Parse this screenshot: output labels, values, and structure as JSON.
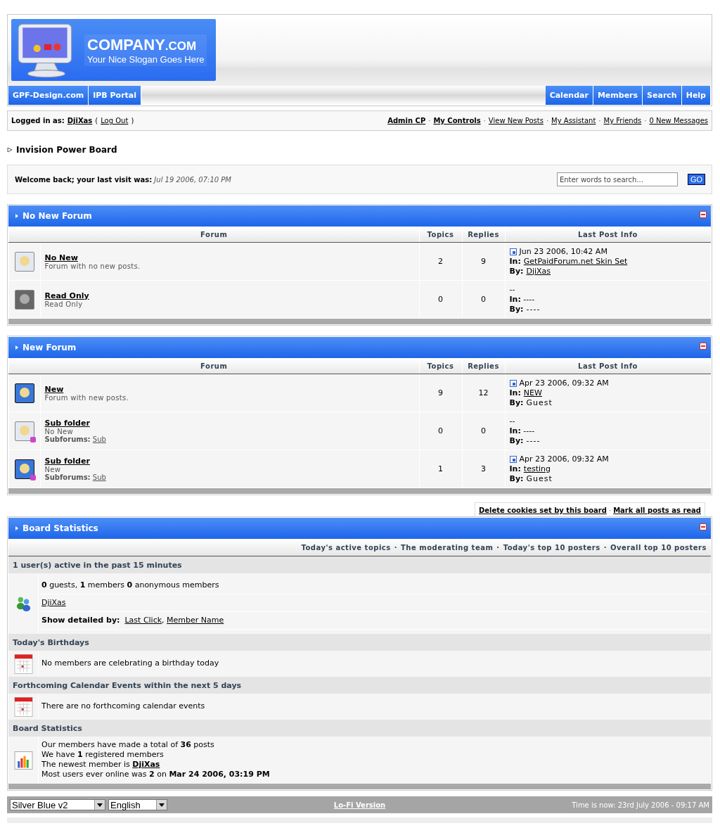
{
  "logo": {
    "name": "COMPANY",
    "suffix": ".COM",
    "slogan": "Your Nice Slogan Goes Here"
  },
  "nav_left": [
    "GPF-Design.com",
    "IPB Portal"
  ],
  "nav_right": [
    "Calendar",
    "Members",
    "Search",
    "Help"
  ],
  "userbar": {
    "label": "Logged in as:",
    "user": "DjiXas",
    "open": "(",
    "logout": "Log Out",
    "close": ")",
    "separator": "·",
    "links": [
      {
        "text": "Admin CP",
        "bold": true
      },
      {
        "text": "My Controls",
        "bold": true
      },
      {
        "text": "View New Posts",
        "bold": false
      },
      {
        "text": "My Assistant",
        "bold": false
      },
      {
        "text": "My Friends",
        "bold": false
      },
      {
        "text": "0 New Messages",
        "bold": false
      }
    ]
  },
  "breadcrumb": "Invision Power Board",
  "welcome": {
    "label": "Welcome back; your last visit was:",
    "date": "Jul 19 2006, 07:10 PM",
    "search_placeholder": "Enter words to search...",
    "go": "GO"
  },
  "categories": [
    {
      "title": "No New Forum",
      "columns": [
        "Forum",
        "Topics",
        "Replies",
        "Last Post Info"
      ],
      "forums": [
        {
          "new": false,
          "read_only": false,
          "name": "No New",
          "desc": "Forum with no new posts.",
          "topics": "2",
          "replies": "9",
          "last": {
            "post_icon": true,
            "date": "Jun 23 2006, 10:42 AM",
            "in_label": "In:",
            "in": "GetPaidForum.net Skin Set",
            "in_link": true,
            "by_label": "By:",
            "by": "DjiXas",
            "by_link": true
          }
        },
        {
          "read_only": true,
          "name": "Read Only",
          "desc": "Read Only",
          "topics": "0",
          "replies": "0",
          "last": {
            "post_icon": false,
            "date": "--",
            "in_label": "In:",
            "in": "----",
            "in_link": false,
            "by_label": "By:",
            "by": "----",
            "by_link": false
          }
        }
      ]
    },
    {
      "title": "New Forum",
      "columns": [
        "Forum",
        "Topics",
        "Replies",
        "Last Post Info"
      ],
      "forums": [
        {
          "new": true,
          "read_only": false,
          "name": "New",
          "desc": "Forum with new posts.",
          "topics": "9",
          "replies": "12",
          "last": {
            "post_icon": true,
            "date": "Apr 23 2006, 09:32 AM",
            "in_label": "In:",
            "in": "NEW",
            "in_link": true,
            "by_label": "By:",
            "by": "Guest",
            "by_link": false
          }
        },
        {
          "new": false,
          "read_only": false,
          "name": "Sub folder",
          "desc": "No New",
          "subforums_label": "Subforums:",
          "subforum": "Sub",
          "topics": "0",
          "replies": "0",
          "last": {
            "post_icon": false,
            "date": "--",
            "in_label": "In:",
            "in": "----",
            "in_link": false,
            "by_label": "By:",
            "by": "----",
            "by_link": false
          }
        },
        {
          "new": true,
          "read_only": false,
          "name": "Sub folder",
          "desc": "New",
          "subforums_label": "Subforums:",
          "subforum": "Sub",
          "topics": "1",
          "replies": "3",
          "last": {
            "post_icon": true,
            "date": "Apr 23 2006, 09:32 AM",
            "in_label": "In:",
            "in": "testing",
            "in_link": true,
            "by_label": "By:",
            "by": "Guest",
            "by_link": false
          }
        }
      ]
    }
  ],
  "board_links": {
    "separator": "·",
    "items": [
      "Delete cookies set by this board",
      "Mark all posts as read"
    ]
  },
  "stats": {
    "title": "Board Statistics",
    "separator": "·",
    "links": [
      "Today's active topics",
      "The moderating team",
      "Today's top 10 posters",
      "Overall top 10 posters"
    ],
    "sections": [
      {
        "heading": "1 user(s) active in the past 15 minutes",
        "kind": "users",
        "lines": [
          {
            "text": "**0** guests, **1** members **0** anonymous members"
          },
          {
            "link": "DjiXas"
          },
          {
            "label": "Show detailed by:",
            "separator": ",",
            "links": [
              "Last Click",
              "Member Name"
            ]
          }
        ]
      },
      {
        "heading": "Today's Birthdays",
        "kind": "calendar",
        "lines": [
          {
            "text": "No members are celebrating a birthday today"
          }
        ]
      },
      {
        "heading": "Forthcoming Calendar Events within the next 5 days",
        "kind": "calendar",
        "lines": [
          {
            "text": "There are no forthcoming calendar events"
          }
        ]
      },
      {
        "heading": "Board Statistics",
        "kind": "chart",
        "lines": [
          {
            "text": "Our members have made a total of **36** posts"
          },
          {
            "text": "We have **1** registered members"
          },
          {
            "text": "The newest member is",
            "bold_link": "DjiXas"
          },
          {
            "text": "Most users ever online was **2** on **Mar 24 2006, 03:19 PM**"
          }
        ]
      }
    ]
  },
  "footer": {
    "skin": "Silver Blue v2",
    "language": "English",
    "lofi": "Lo-Fi Version",
    "time": "Time is now: 23rd July 2006 - 09:17 AM"
  }
}
